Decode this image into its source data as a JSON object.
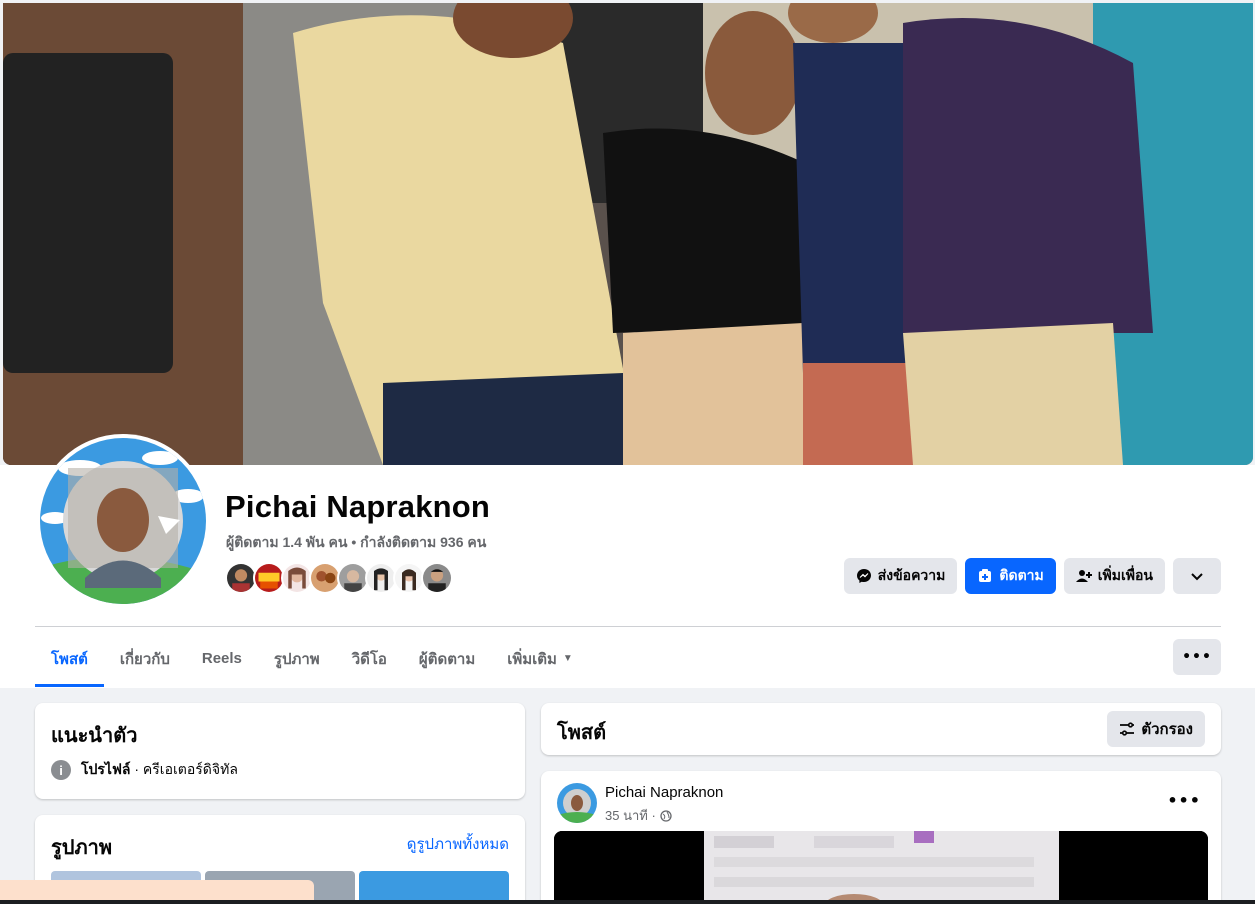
{
  "profile": {
    "name": "Pichai Napraknon",
    "stats": "ผู้ติดตาม 1.4 พัน คน • กำลังติดตาม 936 คน"
  },
  "actions": {
    "message_label": "ส่งข้อความ",
    "follow_label": "ติดตาม",
    "add_friend_label": "เพิ่มเพื่อน"
  },
  "tabs": [
    {
      "label": "โพสต์",
      "active": true
    },
    {
      "label": "เกี่ยวกับ"
    },
    {
      "label": "Reels"
    },
    {
      "label": "รูปภาพ"
    },
    {
      "label": "วิดีโอ"
    },
    {
      "label": "ผู้ติดตาม"
    },
    {
      "label": "เพิ่มเติม"
    }
  ],
  "intro": {
    "title": "แนะนำตัว",
    "profile_label": "โปรไฟล์",
    "profile_category": " · ครีเอเตอร์ดิจิทัล"
  },
  "photos": {
    "title": "รูปภาพ",
    "see_all": "ดูรูปภาพทั้งหมด"
  },
  "posts": {
    "title": "โพสต์",
    "filter_label": "ตัวกรอง"
  },
  "post": {
    "author": "Pichai Napraknon",
    "time": "35 นาที ·"
  },
  "colors": {
    "accent": "#0866ff",
    "button_gray": "#e4e6eb",
    "muted_text": "#65676b",
    "page_bg": "#f0f2f5"
  }
}
